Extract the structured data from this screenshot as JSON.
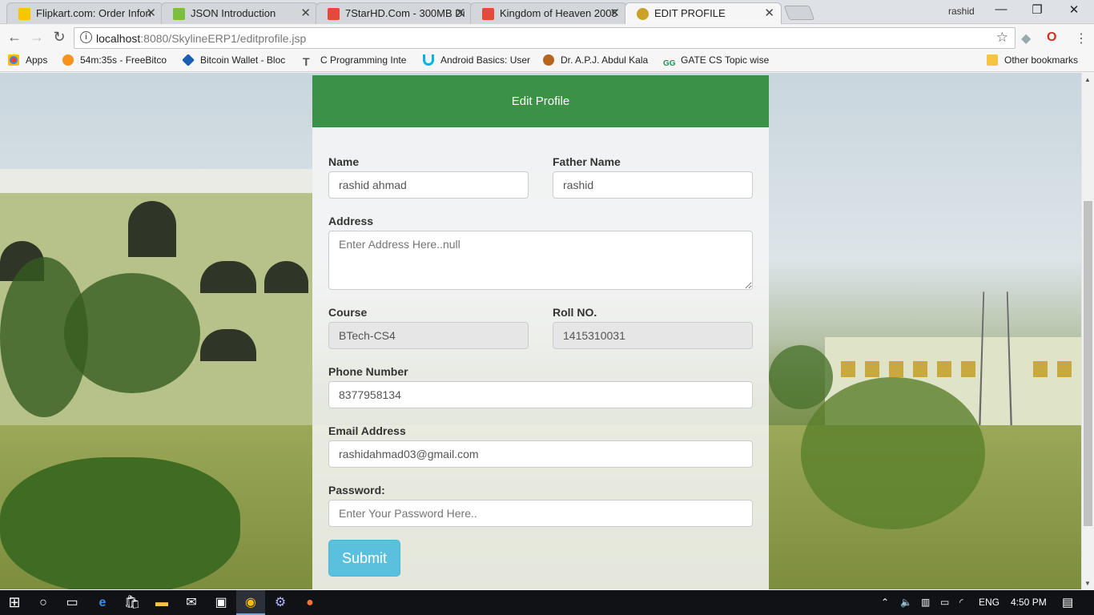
{
  "browser": {
    "tabs": [
      {
        "title": "Flipkart.com: Order Inforr",
        "icon_color": "#f7c600"
      },
      {
        "title": "JSON Introduction",
        "icon_color": "#7bbf3a"
      },
      {
        "title": "7StarHD.Com - 300MB Di",
        "icon_color": "#e24b3b"
      },
      {
        "title": "Kingdom of Heaven 2005",
        "icon_color": "#e24b3b"
      },
      {
        "title": "EDIT PROFILE",
        "icon_color": "#c9a227"
      }
    ],
    "close_glyph": "✕",
    "profile_name": "rashid",
    "window_controls": {
      "minimize": "—",
      "restore": "❐",
      "close": "✕"
    },
    "url_host": "localhost",
    "url_path": ":8080/SkylineERP1/editprofile.jsp",
    "bookmarks": [
      {
        "label": "Apps",
        "icon_color": "#e94235"
      },
      {
        "label": "54m:35s - FreeBitco",
        "icon_color": "#f7931a"
      },
      {
        "label": "Bitcoin Wallet - Bloc",
        "icon_color": "#1a5fb4"
      },
      {
        "label": "C Programming Inte",
        "icon_color": "#555555"
      },
      {
        "label": "Android Basics: User",
        "icon_color": "#02b3e4"
      },
      {
        "label": "Dr. A.P.J. Abdul Kala",
        "icon_color": "#b5651d"
      },
      {
        "label": "GATE CS Topic wise",
        "icon_color": "#2e8b57"
      },
      {
        "label": "Other bookmarks",
        "icon_color": "#f6c343"
      }
    ]
  },
  "form": {
    "header": "Edit Profile",
    "name_label": "Name",
    "name_value": "rashid ahmad",
    "father_label": "Father Name",
    "father_value": "rashid",
    "address_label": "Address",
    "address_placeholder": "Enter Address Here..null",
    "course_label": "Course",
    "course_value": "BTech-CS4",
    "roll_label": "Roll NO.",
    "roll_value": "1415310031",
    "phone_label": "Phone Number",
    "phone_value": "8377958134",
    "email_label": "Email Address",
    "email_value": "rashidahmad03@gmail.com",
    "password_label": "Password:",
    "password_placeholder": "Enter Your Password Here..",
    "submit_label": "Submit",
    "header_color": "#3b9146",
    "submit_color": "#5bc0de"
  },
  "taskbar": {
    "language": "ENG",
    "time": "4:50 PM"
  }
}
